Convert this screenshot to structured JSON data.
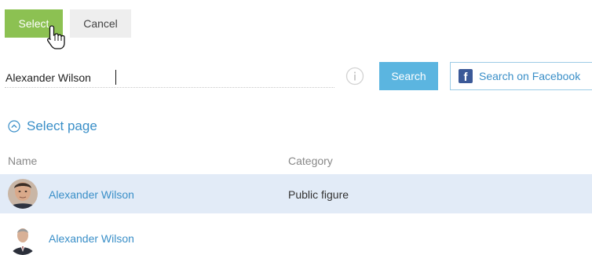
{
  "toolbar": {
    "select_label": "Select",
    "cancel_label": "Cancel"
  },
  "search": {
    "value": "Alexander Wilson",
    "button_label": "Search",
    "facebook_button_label": "Search on Facebook"
  },
  "section": {
    "toggle_label": "Select page"
  },
  "table": {
    "columns": [
      "Name",
      "Category"
    ],
    "rows": [
      {
        "name": "Alexander Wilson",
        "category": "Public figure",
        "selected": true
      },
      {
        "name": "Alexander Wilson",
        "category": "",
        "selected": false
      }
    ]
  },
  "colors": {
    "select_button": "#8cc152",
    "search_button": "#5bb5e0",
    "link": "#3a8fc8",
    "selected_row": "#e2ebf7",
    "facebook": "#3b5998"
  },
  "icons": [
    "pointer-cursor-icon",
    "info-icon",
    "facebook-icon",
    "collapse-chevron-icon"
  ]
}
